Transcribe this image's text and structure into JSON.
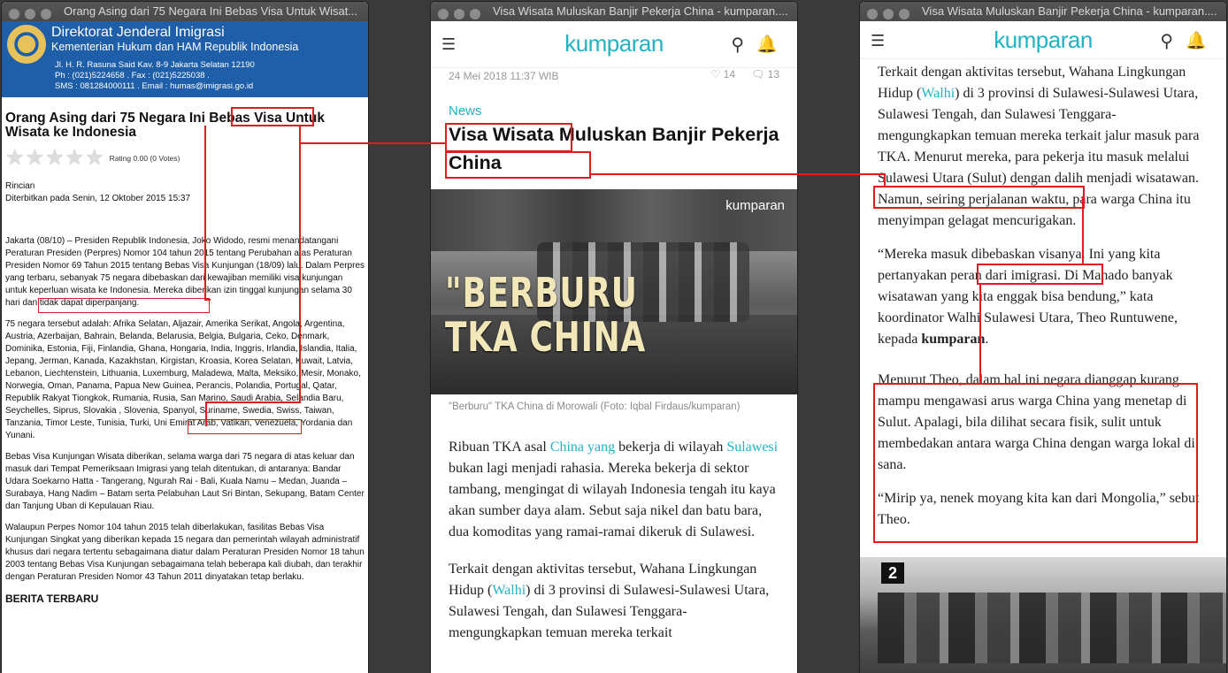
{
  "windows": {
    "left": {
      "title": "Orang Asing dari 75 Negara Ini Bebas Visa Untuk Wisat...",
      "header": {
        "title": "Direktorat Jenderal Imigrasi",
        "subtitle": "Kementerian Hukum dan HAM Republik Indonesia",
        "address1": "Jl. H. R. Rasuna Said Kav. 8-9 Jakarta Selatan 12190",
        "address2": "Ph : (021)5224658 . Fax : (021)5225038 .",
        "address3": "SMS : 081284000111 . Email : humas@imigrasi.go.id"
      },
      "headline_part1": "Orang Asing dari 75 Negara Ini ",
      "headline_highlight": "Bebas Visa",
      "headline_part2": " Untuk Wisata ke Indonesia",
      "rating": "Rating 0.00 (0 Votes)",
      "rincian": "Rincian",
      "published": "Diterbitkan pada Senin, 12 Oktober 2015 15:37",
      "p1_a": "Jakarta (08/10) – Presiden Republik Indonesia, Joko Widodo, resmi menandatangani Peraturan Presiden (Perpres) Nomor 104 tahun 2015 tentang Perubahan atas Peraturan Presiden Nomor 69 Tahun 2015 tentang Bebas Visa Kunjungan (18/09) lalu. Dalam Perpres yang terbaru, sebanyak 75 negara dibebaskan dari kewajiban memiliki ",
      "p1_highlight": "visa kunjungan untuk keperluan wisata",
      "p1_b": " ke Indonesia. Mereka diberikan izin tinggal kunjungan selama 30 hari dan tidak dapat diperpanjang.",
      "p2_a": "75 negara tersebut adalah: Afrika Selatan, Aljazair, Amerika Serikat, Angola, Argentina, Austria, Azerbaijan, Bahrain, Belanda, Belarusia, Belgia, Bulgaria, Ceko, Denmark, Dominika, Estonia, Fiji, Finlandia, Ghana, Hongaria, India, Inggris, Irlandia, Islandia, Italia, Jepang, Jerman, Kanada, Kazakhstan, Kirgistan, Kroasia, Korea Selatan, Kuwait, Latvia, Lebanon, Liechtenstein, Lithuania, Luxemburg, Maladewa, Malta, Meksiko, Mesir, Monako, Norwegia, Oman, Panama, Papua New Guinea, Perancis, Polandia, Portugal, Qatar, ",
      "p2_highlight": "Republik Rakyat Tiongkok",
      "p2_b": ", Rumania, Rusia, San Marino, Saudi Arabia, Selandia Baru, Seychelles, Siprus, Slovakia , Slovenia, Spanyol, Suriname, Swedia, Swiss, Taiwan, Tanzania, Timor Leste, Tunisia, Turki, Uni Emirat Arab, Vatikan, Venezuela, Yordania dan Yunani.",
      "p3": "Bebas Visa Kunjungan Wisata diberikan, selama warga dari 75 negara di atas keluar dan masuk dari Tempat Pemeriksaan Imigrasi yang telah ditentukan, di antaranya: Bandar Udara Soekarno Hatta - Tangerang, Ngurah Rai - Bali, Kuala Namu – Medan, Juanda – Surabaya, Hang Nadim – Batam serta Pelabuhan Laut Sri Bintan, Sekupang, Batam Center dan Tanjung Uban di Kepulauan Riau.",
      "p4": "Walaupun Perpes Nomor 104 tahun 2015 telah diberlakukan, fasilitas Bebas Visa Kunjungan Singkat yang diberikan kepada 15 negara dan pemerintah wilayah administratif khusus dari negara tertentu sebagaimana diatur dalam Peraturan Presiden Nomor 18 tahun 2003 tentang Bebas Visa Kunjungan sebagaimana telah beberapa kali diubah, dan terakhir dengan Peraturan Presiden Nomor 43 Tahun 2011 dinyatakan tetap berlaku.",
      "footer_cut": "BERITA TERBARU"
    },
    "middle": {
      "title": "Visa Wisata Muluskan Banjir Pekerja China - kumparan....",
      "logo": "kumparan",
      "date": "24 Mei 2018 11:37 WIB",
      "likes": "14",
      "comments": "13",
      "category": "News",
      "headline_hl1": "Visa Wisata",
      "headline_mid": " Muluskan Banjir ",
      "headline_hl2": "Pekerja China",
      "hero_text1": "\"BERBURU",
      "hero_text2": "TKA CHINA",
      "hero_watermark": "kumparan",
      "caption": "\"Berburu\" TKA China di Morowali (Foto: Iqbal Firdaus/kumparan)",
      "para1_a": "Ribuan TKA asal ",
      "para1_link1": "China yang",
      "para1_b": " bekerja di wilayah ",
      "para1_link2": "Sulawesi",
      "para1_c": " bukan lagi menjadi rahasia. Mereka bekerja di sektor tambang, mengingat di wilayah Indonesia tengah itu kaya akan sumber daya alam. Sebut saja nikel dan batu bara, dua komoditas yang ramai-ramai dikeruk di Sulawesi.",
      "para2_a": "Terkait dengan aktivitas tersebut, Wahana Lingkungan Hidup (",
      "para2_link": "Walhi",
      "para2_b": ") di 3 provinsi di Sulawesi-Sulawesi Utara, Sulawesi Tengah, dan Sulawesi Tenggara- mengungkapkan temuan mereka terkait"
    },
    "right": {
      "title": "Visa Wisata Muluskan Banjir Pekerja China - kumparan....",
      "logo": "kumparan",
      "p1_a": "Terkait dengan aktivitas tersebut, Wahana Lingkungan Hidup (",
      "p1_link": "Walhi",
      "p1_b": ") di 3 provinsi di Sulawesi-Sulawesi Utara, Sulawesi Tengah, dan Sulawesi Tenggara- mengungkapkan temuan mereka terkait jalur masuk para TKA. Menurut mereka, para pekerja itu masuk melalui Sulawesi Utara (Sulut) ",
      "p1_highlight": "dengan dalih menjadi wisatawan",
      "p1_c": ". Namun, seiring perjalanan waktu, para warga China itu menyimpan gelagat mencurigakan.",
      "p2_a": "“Mereka masuk ",
      "p2_highlight": "dibebaskan visanya",
      "p2_b": ". Ini yang kita pertanyakan peran dari imigrasi. Di Manado banyak wisatawan yang kita enggak bisa bendung,” kata koordinator Walhi Sulawesi Utara, Theo Runtuwene, kepada ",
      "p2_bold": "kumparan",
      "p2_c": ".",
      "p3": "Menurut Theo, dalam hal ini negara dianggap kurang mampu mengawasi arus warga China yang menetap di Sulut.  Apalagi, bila dilihat secara fisik, sulit untuk membedakan antara warga China dengan warga lokal di sana.",
      "p4": "“Mirip ya, nenek moyang kita kan dari Mongolia,” sebut Theo.",
      "image_sign": "2"
    }
  },
  "colors": {
    "annotation_red": "#e01c1c",
    "kumparan_teal": "#1fb3c4",
    "imigrasi_blue": "#1f5ea8"
  }
}
